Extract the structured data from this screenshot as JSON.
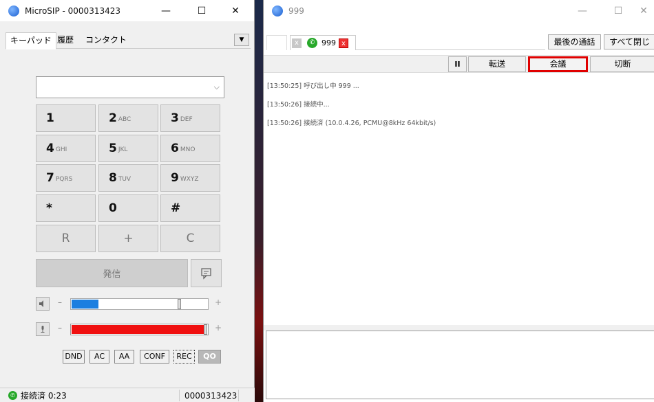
{
  "left_window": {
    "title": "MicroSIP - 0000313423",
    "controls": {
      "minimize": "—",
      "maximize": "☐",
      "close": "✕"
    },
    "tabs": [
      {
        "label": "キーパッド",
        "active": true
      },
      {
        "label": "履歴",
        "active": false
      },
      {
        "label": "コンタクト",
        "active": false
      }
    ],
    "tab_dropdown": "▼",
    "dial_input": {
      "value": "",
      "chevron": "⌵"
    },
    "keypad": [
      {
        "digit": "1",
        "sub": ""
      },
      {
        "digit": "2",
        "sub": "ABC"
      },
      {
        "digit": "3",
        "sub": "DEF"
      },
      {
        "digit": "4",
        "sub": "GHI"
      },
      {
        "digit": "5",
        "sub": "JKL"
      },
      {
        "digit": "6",
        "sub": "MNO"
      },
      {
        "digit": "7",
        "sub": "PQRS"
      },
      {
        "digit": "8",
        "sub": "TUV"
      },
      {
        "digit": "9",
        "sub": "WXYZ"
      },
      {
        "digit": "*",
        "sub": ""
      },
      {
        "digit": "0",
        "sub": ""
      },
      {
        "digit": "#",
        "sub": ""
      }
    ],
    "extra_keys": {
      "r": "R",
      "plus": "+",
      "c": "C"
    },
    "call_button": "発信",
    "speaker": {
      "minus": "–",
      "plus": "+",
      "level": 0.2
    },
    "mic": {
      "minus": "–",
      "plus": "+",
      "level": 0.98
    },
    "options": {
      "dnd": "DND",
      "ac": "AC",
      "aa": "AA",
      "conf": "CONF",
      "rec": "REC",
      "voicemail": "QO"
    },
    "status": {
      "text": "接続済 0:23",
      "account": "0000313423"
    },
    "colors": {
      "speaker_fill": "#1c7fe0",
      "mic_fill": "#f01010",
      "status_green": "#27a82a"
    }
  },
  "right_window": {
    "title": "999",
    "controls": {
      "minimize": "—",
      "maximize": "☐",
      "close": "✕"
    },
    "call_tab": {
      "number": "999",
      "close_grey": "x",
      "close_red": "x"
    },
    "buttons": {
      "last_call": "最後の通話",
      "close_all": "すべて閉じ"
    },
    "toolbar": {
      "hold": "II",
      "transfer": "転送",
      "conference": "会議",
      "hangup": "切断"
    },
    "log": [
      "[13:50:25] 呼び出し中 999 ...",
      "[13:50:26] 接続中...",
      "[13:50:26] 接続済 (10.0.4.26, PCMU@8kHz 64kbit/s)"
    ],
    "colors": {
      "highlight": "#e00000"
    }
  }
}
